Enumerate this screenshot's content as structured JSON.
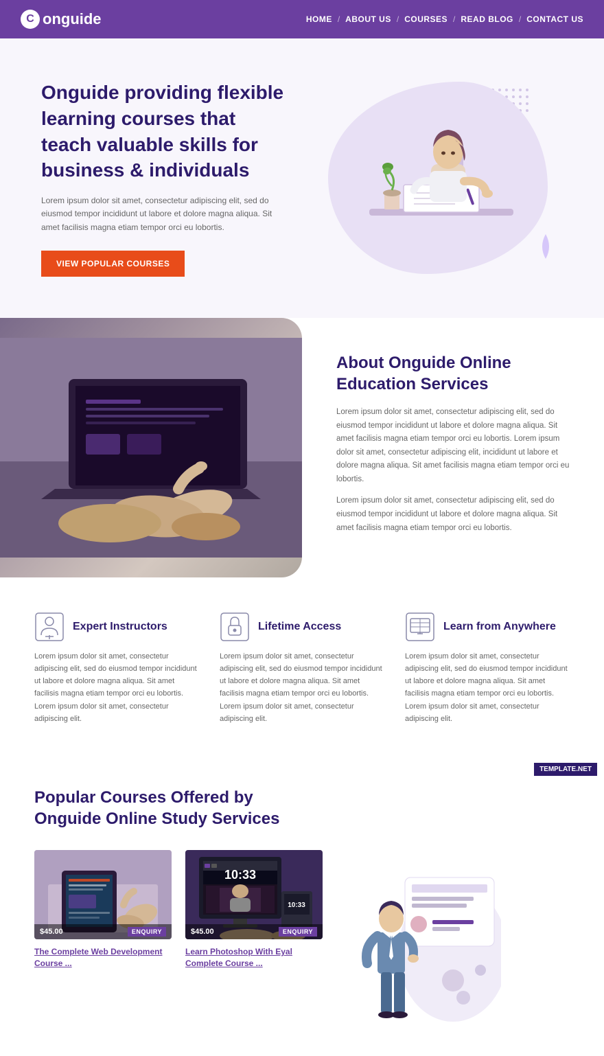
{
  "header": {
    "logo": "onguide",
    "nav": [
      {
        "label": "HOME",
        "href": "#"
      },
      {
        "label": "ABOUT US",
        "href": "#"
      },
      {
        "label": "COURSES",
        "href": "#"
      },
      {
        "label": "READ BLOG",
        "href": "#"
      },
      {
        "label": "CONTACT US",
        "href": "#"
      }
    ]
  },
  "hero": {
    "title": "Onguide providing flexible learning courses that teach valuable skills for business & individuals",
    "desc": "Lorem ipsum dolor sit amet, consectetur adipiscing elit, sed do eiusmod tempor incididunt ut labore et dolore magna aliqua. Sit amet facilisis magna etiam tempor orci eu lobortis.",
    "cta": "VIEW POPULAR COURSES"
  },
  "about": {
    "title": "About Onguide Online Education Services",
    "para1": "Lorem ipsum dolor sit amet, consectetur adipiscing elit, sed do eiusmod tempor incididunt ut labore et dolore magna aliqua. Sit amet facilisis magna etiam tempor orci eu lobortis. Lorem ipsum dolor sit amet, consectetur adipiscing elit, incididunt ut labore et dolore magna aliqua. Sit amet facilisis magna etiam tempor orci eu lobortis.",
    "para2": "Lorem ipsum dolor sit amet, consectetur adipiscing elit, sed do eiusmod tempor incididunt ut labore et dolore magna aliqua. Sit amet facilisis magna etiam tempor orci eu lobortis."
  },
  "features": [
    {
      "icon": "instructor-icon",
      "title": "Expert Instructors",
      "desc": "Lorem ipsum dolor sit amet, consectetur adipiscing elit, sed do eiusmod tempor incididunt ut labore et dolore magna aliqua. Sit amet facilisis magna etiam tempor orci eu lobortis. Lorem ipsum dolor sit amet, consectetur adipiscing elit."
    },
    {
      "icon": "lock-icon",
      "title": "Lifetime Access",
      "desc": "Lorem ipsum dolor sit amet, consectetur adipiscing elit, sed do eiusmod tempor incididunt ut labore et dolore magna aliqua. Sit amet facilisis magna etiam tempor orci eu lobortis. Lorem ipsum dolor sit amet, consectetur adipiscing elit."
    },
    {
      "icon": "globe-icon",
      "title": "Learn from Anywhere",
      "desc": "Lorem ipsum dolor sit amet, consectetur adipiscing elit, sed do eiusmod tempor incididunt ut labore et dolore magna aliqua. Sit amet facilisis magna etiam tempor orci eu lobortis. Lorem ipsum dolor sit amet, consectetur adipiscing elit."
    }
  ],
  "courses": {
    "title": "Popular Courses Offered by Onguide Online Study Services",
    "items": [
      {
        "name": "The Complete Web Development Course ...",
        "price": "$45.00",
        "enquiry": "ENQUIRY"
      },
      {
        "name": "Learn Photoshop With Eyal Complete Course ...",
        "price": "$45.00",
        "enquiry": "ENQUIRY"
      }
    ]
  },
  "template": "TEMPLATE.NET"
}
